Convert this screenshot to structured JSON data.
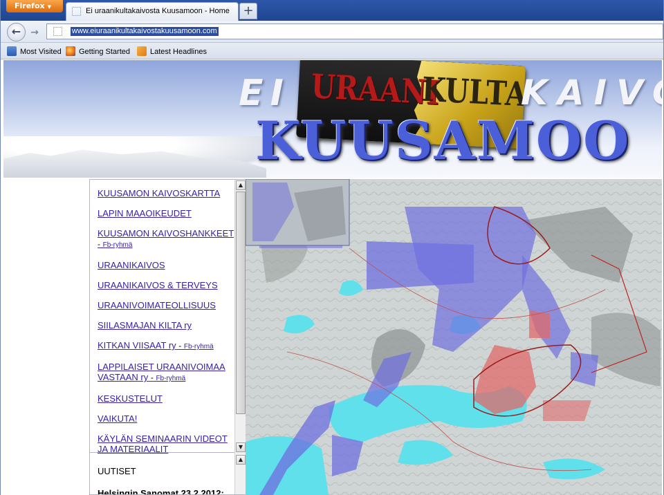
{
  "browser": {
    "menu_button": "Firefox",
    "tab_title": "Ei uraanikultakaivosta Kuusamoon - Home",
    "new_tab": "+",
    "url": "www.eiuraanikultakaivostakuusamoon.com",
    "bookmarks": [
      "Most Visited",
      "Getting Started",
      "Latest Headlines"
    ]
  },
  "banner": {
    "word_ei": "EI",
    "word_uraani": "URAANI",
    "word_kulta": "KULTA",
    "word_kaivo": "KAIVO",
    "word_kuusamo": "KUUSAMOO"
  },
  "nav": {
    "items": [
      {
        "label": "KUUSAMON KAIVOSKARTTA"
      },
      {
        "label": "LAPIN MAAOIKEUDET"
      },
      {
        "label": "KUUSAMON KAIVOSHANKKEET",
        "sep": "-",
        "fb": "Fb-ryhmä"
      },
      {
        "label": "URAANIKAIVOS"
      },
      {
        "label": "URAANIKAIVOS & TERVEYS"
      },
      {
        "label": "URAANIVOIMATEOLLISUUS"
      },
      {
        "label": "SIILASMAJAN KILTA ry"
      },
      {
        "label": "KITKAN VIISAAT ry",
        "sep": "-",
        "fb": "Fb-ryhmä"
      },
      {
        "label": "LAPPILAISET URAANIVOIMAA VASTAAN ry",
        "sep": "-",
        "fb": "Fb-ryhmä"
      },
      {
        "label": "KESKUSTELUT"
      },
      {
        "label": "VAIKUTA!"
      },
      {
        "label": "KÄYLÄN SEMINAARIN VIDEOT JA MATERIAALIT"
      }
    ],
    "news_heading": "UUTISET",
    "news_line": "Helsingin Sanomat 23.2.2012:"
  },
  "map": {
    "description_icon": "mining-claims-map",
    "colors": {
      "claim_blue": "#6f6fe0",
      "claim_red": "#e06a6a",
      "water": "#5fe0ea",
      "terrain": "#cdd3d2"
    }
  }
}
